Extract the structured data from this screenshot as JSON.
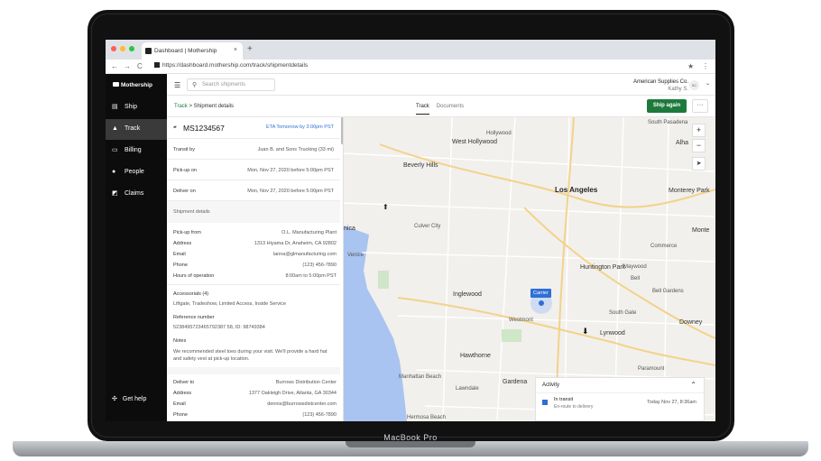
{
  "device": {
    "label": "MacBook Pro"
  },
  "browser": {
    "tab_title": "Dashboard | Mothership",
    "tab_close": "×",
    "new_tab": "+",
    "url": "https://dashboard.mothership.com/track/shipmentdetails",
    "back": "←",
    "forward": "→",
    "reload": "C",
    "star": "★",
    "menu": "⋮"
  },
  "sidebar": {
    "brand": "Mothership",
    "items": [
      {
        "label": "Ship",
        "icon": "ship-icon"
      },
      {
        "label": "Track",
        "icon": "track-icon"
      },
      {
        "label": "Billing",
        "icon": "billing-icon"
      },
      {
        "label": "People",
        "icon": "people-icon"
      },
      {
        "label": "Claims",
        "icon": "claims-icon"
      }
    ],
    "help": "Get help"
  },
  "topbar": {
    "search_placeholder": "Search shipments",
    "company": "American Supplies Co.",
    "user": "Kathy S.",
    "avatar_initials": "SC"
  },
  "subbar": {
    "crumb_root": "Track",
    "crumb_sep": ">",
    "crumb_current": "Shipment details",
    "tab_track": "Track",
    "tab_documents": "Documents",
    "ship_again": "Ship again",
    "more": "···"
  },
  "shipment": {
    "id": "MS1234567",
    "eta": "ETA Tomorrow by 3:00pm PST",
    "transit_label": "Transit by",
    "transit_value": "Juan B. and Sons Trucking (33 mi)",
    "pickup_label": "Pick-up on",
    "pickup_value": "Mon, Nov 27, 2020 before 5:00pm PST",
    "deliver_label": "Deliver on",
    "deliver_value": "Mon, Nov 27, 2020 before 5:00pm PST",
    "details_header": "Shipment details",
    "pickup_from_label": "Pick-up from",
    "pickup_from_value": "O.L. Manufacturing Plant",
    "address_label": "Address",
    "address_value": "1313 Hiyama Dr, Anaheim, CA 92802",
    "email_label": "Email",
    "email_value": "lanna@glmanufacturing.com",
    "phone_label": "Phone",
    "phone_value": "(123) 456-7890",
    "hours_label": "Hours of operation",
    "hours_value": "8:00am to 5:00pm PST",
    "accessorials_label": "Accessorials (4)",
    "accessorials_value": "Liftgate, Tradeshow, Limited Access, Inside Service",
    "reference_label": "Reference number",
    "reference_value": "5238495723465792387 58, ID: 98749384",
    "notes_label": "Notes",
    "notes_value": "We recommended steel toes during your visit. We'll provide a hard hat and safety vest at pick-up location.",
    "deliver_to_label": "Deliver to",
    "deliver_to_value": "Burrows Distribution Center",
    "d_address_label": "Address",
    "d_address_value": "1377 Oakleigh Drive, Atlanta, GA 30344",
    "d_email_label": "Email",
    "d_email_value": "dennis@burrowsdistcenter.com",
    "d_phone_label": "Phone",
    "d_phone_value": "(123) 456-7890"
  },
  "map": {
    "labels": {
      "west_hollywood": "West Hollywood",
      "beverly_hills": "Beverly Hills",
      "los_angeles": "Los Angeles",
      "monterey_park": "Monterey Park",
      "culver_city": "Culver City",
      "inglewood": "Inglewood",
      "huntington_park": "Huntington Park",
      "hawthorne": "Hawthorne",
      "lynwood": "Lynwood",
      "downey": "Downey",
      "gardena": "Gardena",
      "commerce": "Commerce",
      "bell_gardens": "Bell Gardens",
      "maywood": "Maywood",
      "south_gate": "South Gate",
      "westmont": "Westmont",
      "lawndale": "Lawndale",
      "manhattan_beach": "Manhattan Beach",
      "hermosa_beach": "Hermosa Beach",
      "hollywood": "Hollywood",
      "south_pasadena": "South Pasadena",
      "venice": "Venice",
      "monica": "nica",
      "paramount": "Paramount",
      "alhambra": "Alha",
      "monte": "Monte",
      "bell": "Bell"
    },
    "carrier": "Carrier",
    "zoom_in": "+",
    "zoom_out": "−"
  },
  "activity": {
    "title": "Activity",
    "status": "In transit",
    "sub": "En-route to delivery",
    "time": "Today Nov 27, 8:36am"
  },
  "colors": {
    "accent": "#1e7a3c",
    "eta": "#2f6fd6",
    "water": "#a9c4f0"
  }
}
